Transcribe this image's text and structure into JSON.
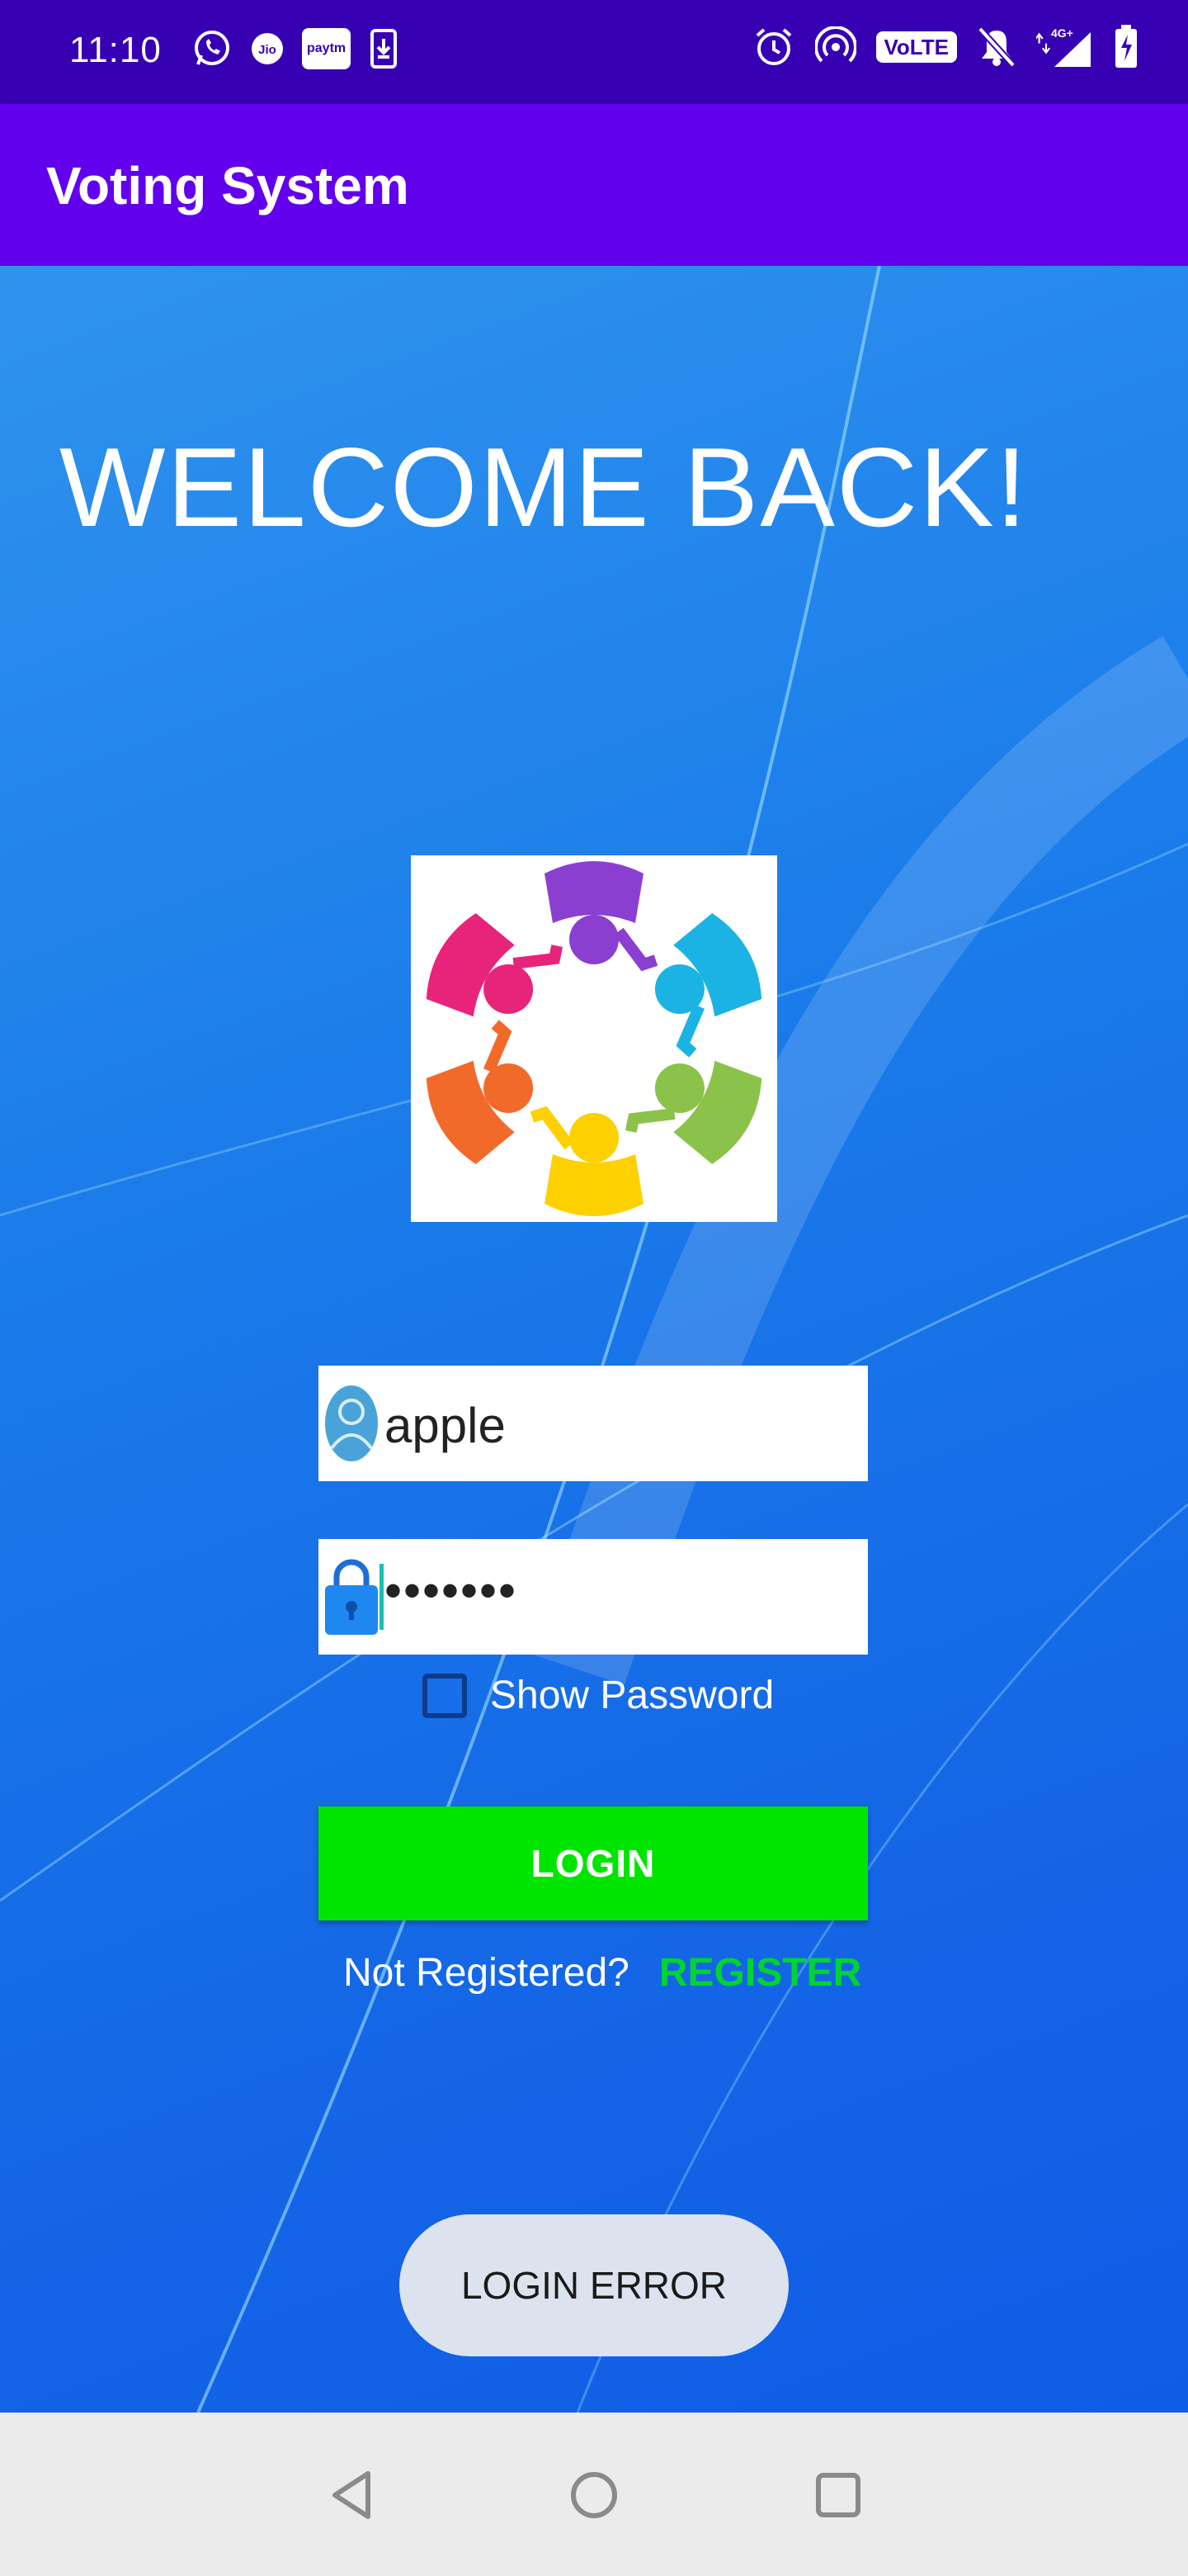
{
  "status_bar": {
    "time": "11:10",
    "left_icons": [
      "whatsapp-icon",
      "jio-icon",
      "paytm-icon",
      "download-icon"
    ],
    "jio_text": "Jio",
    "paytm_text": "paytm",
    "right_icons": [
      "alarm-icon",
      "hotspot-icon",
      "volte-icon",
      "mute-icon",
      "signal-icon",
      "battery-icon"
    ],
    "volte_text": "VoLTE",
    "network_text": "4G+",
    "background": "#3700b3"
  },
  "app_bar": {
    "title": "Voting System",
    "background": "#6200ee"
  },
  "main": {
    "welcome": "WELCOME BACK!",
    "logo_icon": "people-circle-logo",
    "username": {
      "value": "apple",
      "icon": "user-icon"
    },
    "password": {
      "value": "•••••••",
      "icon": "lock-icon"
    },
    "show_password_label": "Show Password",
    "show_password_checked": false,
    "login_button": "LOGIN",
    "login_button_color": "#00e500",
    "not_registered": "Not Registered?",
    "register_link": "REGISTER",
    "register_color": "#00d430"
  },
  "toast": {
    "message": "LOGIN ERROR"
  },
  "nav_bar": {
    "buttons": [
      "back-icon",
      "home-icon",
      "recents-icon"
    ]
  }
}
